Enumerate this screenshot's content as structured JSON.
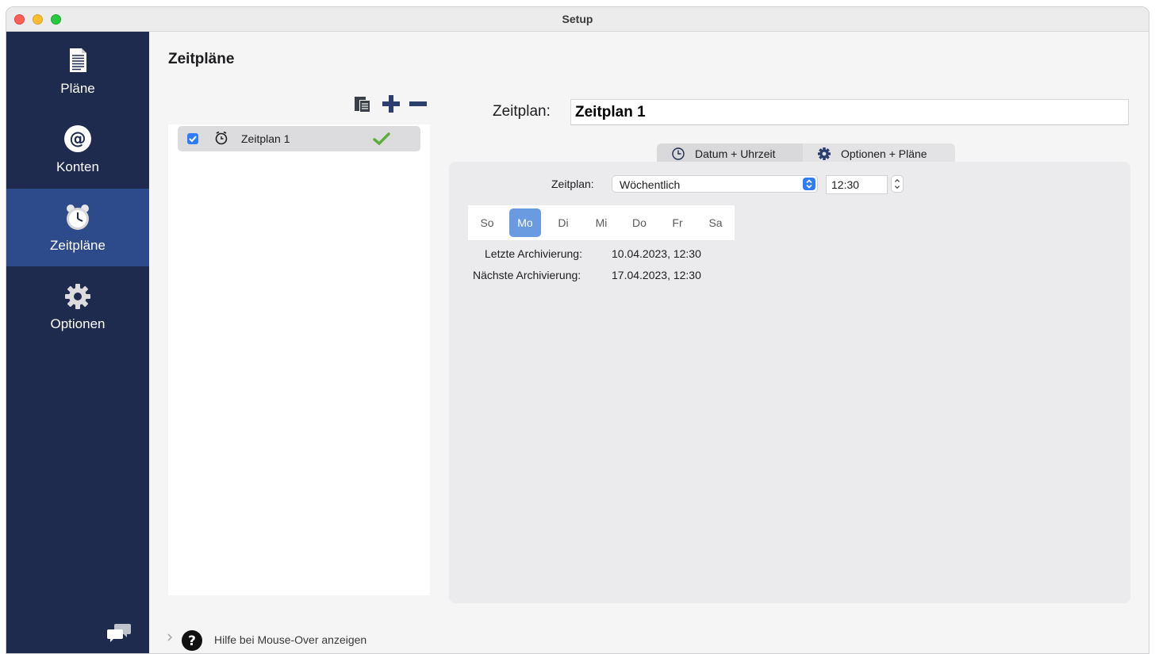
{
  "window": {
    "title": "Setup"
  },
  "sidebar": {
    "items": [
      {
        "label": "Pläne",
        "icon": "document-icon",
        "active": false
      },
      {
        "label": "Konten",
        "icon": "at-icon",
        "active": false
      },
      {
        "label": "Zeitpläne",
        "icon": "alarm-clock-icon",
        "active": true
      },
      {
        "label": "Optionen",
        "icon": "gear-icon",
        "active": false
      }
    ],
    "footer_icon": "chat-bubbles-icon"
  },
  "main": {
    "title": "Zeitpläne",
    "toolbar": {
      "icons": [
        "duplicate-icon",
        "plus-icon",
        "minus-icon"
      ]
    },
    "schedule_list": [
      {
        "checked": true,
        "icon": "alarm-clock-icon",
        "label": "Zeitplan 1",
        "status_icon": "checkmark-icon"
      }
    ],
    "name_field": {
      "label": "Zeitplan:",
      "value": "Zeitplan 1"
    },
    "tabs": [
      {
        "label": "Datum + Uhrzeit",
        "icon": "clock-icon",
        "selected": true
      },
      {
        "label": "Optionen + Pläne",
        "icon": "gear-icon",
        "selected": false
      }
    ],
    "schedule_settings": {
      "frequency_label": "Zeitplan:",
      "frequency_value": "Wöchentlich",
      "time_value": "12:30",
      "days": [
        "So",
        "Mo",
        "Di",
        "Mi",
        "Do",
        "Fr",
        "Sa"
      ],
      "selected_day": "Mo",
      "last_label": "Letzte Archivierung:",
      "last_value": "10.04.2023, 12:30",
      "next_label": "Nächste Archivierung:",
      "next_value": "17.04.2023, 12:30"
    },
    "footer": {
      "help_text": "Hilfe bei Mouse-Over anzeigen"
    }
  },
  "colors": {
    "sidebar_bg": "#1f2a4f",
    "sidebar_active": "#2d4a8a",
    "accent_blue": "#2f7cf6",
    "selected_day": "#6a9ae0",
    "check_green": "#5fae3c"
  }
}
